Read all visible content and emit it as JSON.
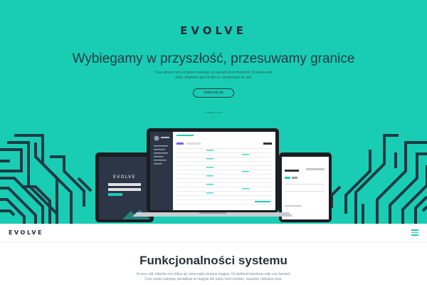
{
  "hero": {
    "logo": "EVOLVE",
    "title": "Wybiegamy w przyszłość, przesuwamy granice",
    "subtitle_lines": [
      "Cras ultrices arcu id ipsum suscipit, at suscipit eros tincidunt. Vivamus ante",
      "dolor, pharetra quis mollis et, consectetur ac nisl."
    ],
    "cta_label": "Zapoznaj się",
    "scroll_hint": "Przejdź w dół",
    "scroll_arrow": "⌄"
  },
  "mockup": {
    "tablet_logo": "EVOLVE"
  },
  "navbar": {
    "logo": "EVOLVE",
    "menu_icon": "hamburger-icon"
  },
  "section": {
    "title": "Funkcjonalności systemu",
    "subtitle_lines": [
      "Ut arcu elit, lobortis nec tellus at, vene natis tempus magna. Ut eleifend maximus odio non laoreet.",
      "Cum sociis natoque penatibus et magnis dis partu rient montes, nascetur ridiculus mus."
    ]
  },
  "colors": {
    "accent": "#19cdb4",
    "dark": "#1d2b38",
    "pattern": "#1f3a44"
  }
}
